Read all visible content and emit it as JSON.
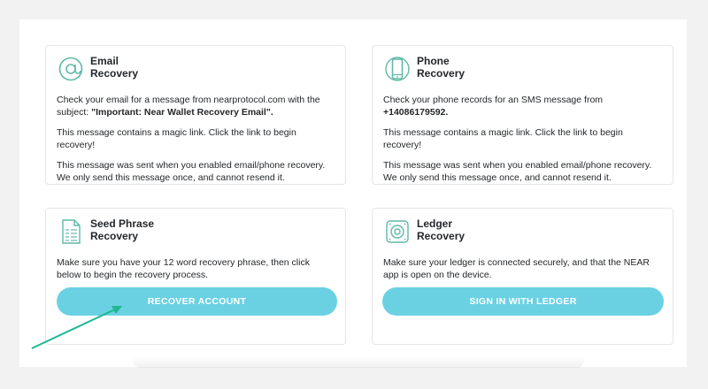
{
  "colors": {
    "background": "#f2f2f2",
    "card_border": "#e6e6e6",
    "icon_teal": "#5fb9a8",
    "button": "#6ad1e3",
    "annotation_arrow": "#1fb890"
  },
  "email": {
    "icon": "at-sign-icon",
    "title_line1": "Email",
    "title_line2": "Recovery",
    "p1_text": "Check your email for a message from nearprotocol.com with the subject: ",
    "p1_bold": "\"Important: Near Wallet Recovery Email\".",
    "p2": "This message contains a magic link. Click the link to begin recovery!",
    "p3": "This message was sent when you enabled email/phone recovery. We only send this message once, and cannot resend it."
  },
  "phone": {
    "icon": "phone-icon",
    "title_line1": "Phone",
    "title_line2": "Recovery",
    "p1_text": "Check your phone records for an SMS message from ",
    "p1_bold": "+14086179592.",
    "p2": "This message contains a magic link. Click the link to begin recovery!",
    "p3": "This message was sent when you enabled email/phone recovery. We only send this message once, and cannot resend it."
  },
  "seed": {
    "icon": "document-list-icon",
    "title_line1": "Seed Phrase",
    "title_line2": "Recovery",
    "p1": "Make sure you have your 12 word recovery phrase, then click below to begin the recovery process.",
    "button_label": "RECOVER ACCOUNT"
  },
  "ledger": {
    "icon": "ledger-device-icon",
    "title_line1": "Ledger",
    "title_line2": "Recovery",
    "p1": "Make sure your ledger is connected securely, and that the NEAR app is open on the device.",
    "button_label": "SIGN IN WITH LEDGER"
  }
}
